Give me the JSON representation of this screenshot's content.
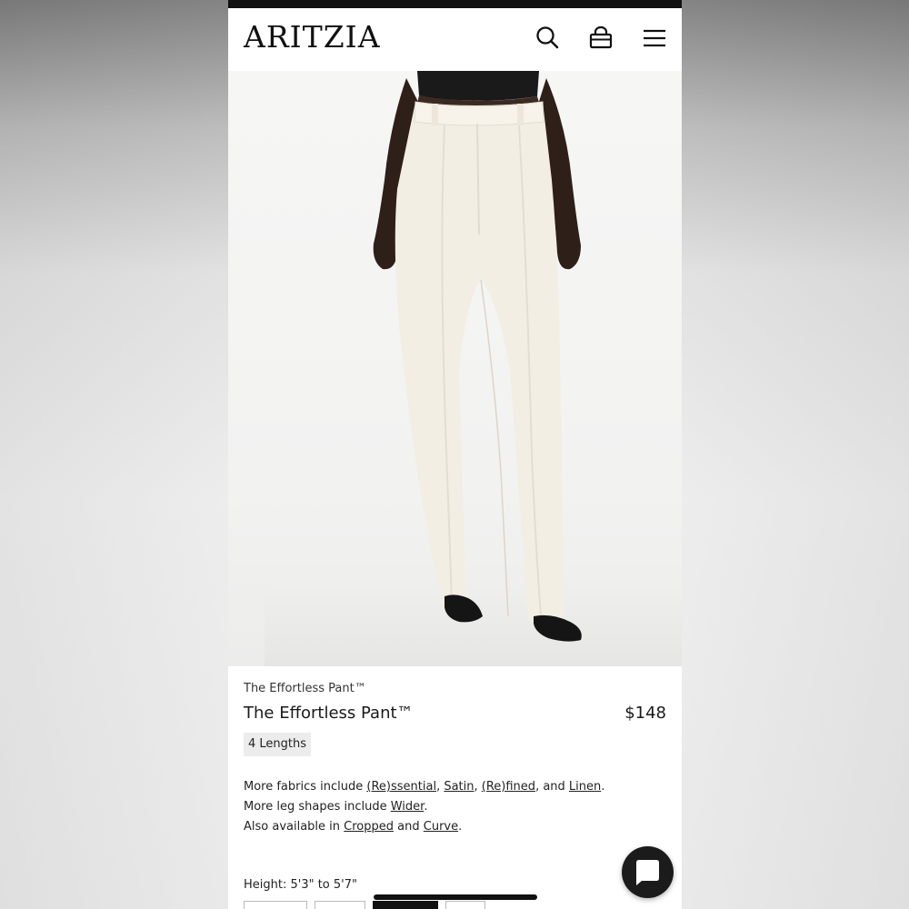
{
  "header": {
    "logo": "ARITZIA",
    "icons": [
      "search-icon",
      "bag-icon",
      "menu-icon"
    ]
  },
  "hero": {
    "image_alt": "Model wearing cream wide-leg trousers with black top and black heeled sandals",
    "carousel_position": 1
  },
  "product": {
    "breadcrumb": "The Effortless Pant™",
    "title": "The Effortless Pant™",
    "price": "$148",
    "lengths_badge": "4 Lengths"
  },
  "description": {
    "fabrics_prefix": "More fabrics include ",
    "fabrics": [
      "(Re)ssential",
      "Satin",
      "(Re)fined",
      "Linen"
    ],
    "sep1": ", ",
    "sep_and": ", and ",
    "end": ".",
    "shapes_prefix": "More leg shapes include ",
    "shape_link": "Wider",
    "also_prefix": "Also available in ",
    "also_links": [
      "Cropped",
      "Curve"
    ],
    "and_word": " and "
  },
  "size_selector": {
    "height_label": "Height: 5'3\" to 5'7\"",
    "selected_index": 2
  },
  "colors": {
    "brand_text": "#111111",
    "hero_bg": "#f4f4f3",
    "pant_cream": "#f3eee4",
    "badge_bg": "#ececec"
  }
}
